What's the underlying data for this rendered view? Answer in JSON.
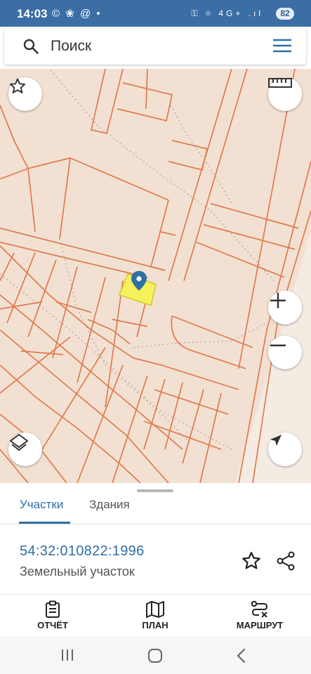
{
  "status_bar": {
    "time": "14:03",
    "left_icons": "© ❀ @ •",
    "right_icons": "⚿ ⌾ 4G+ .ıl",
    "battery": "82"
  },
  "search": {
    "placeholder": "Поиск",
    "search_icon": "search-icon",
    "menu_icon": "hamburger-menu-icon"
  },
  "map": {
    "background_color": "#f2e1d2",
    "parcel_line_color": "#e07a4e",
    "selected_parcel_color": "#f5f15a",
    "pin_color": "#2f6fa3",
    "controls": [
      "favorite-star",
      "ruler",
      "zoom-in",
      "zoom-out",
      "layers",
      "my-location"
    ]
  },
  "tabs": [
    {
      "label": "Участки",
      "active": true
    },
    {
      "label": "Здания",
      "active": false
    }
  ],
  "parcel": {
    "cadastral_number": "54:32:010822:1996",
    "type": "Земельный участок"
  },
  "bottom_nav": [
    {
      "label": "ОТЧЁТ",
      "icon": "report-icon"
    },
    {
      "label": "ПЛАН",
      "icon": "map-plan-icon"
    },
    {
      "label": "МАРШРУТ",
      "icon": "route-icon"
    }
  ],
  "accent_color": "#2f6fa3"
}
